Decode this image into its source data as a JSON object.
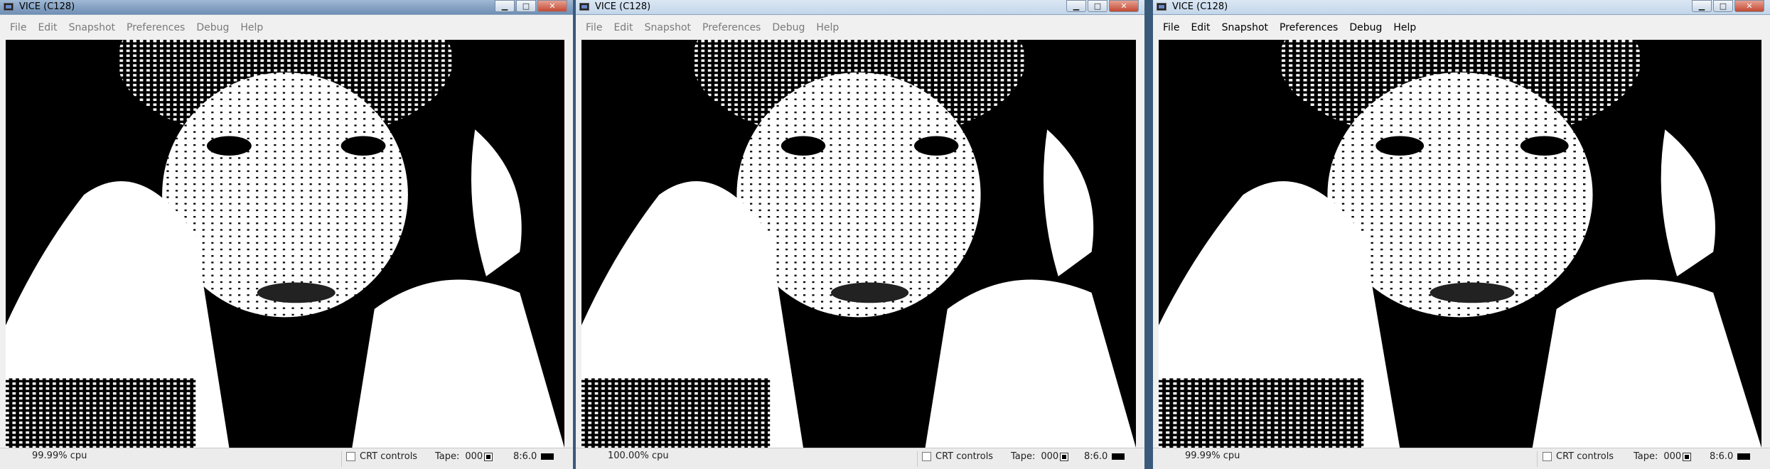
{
  "windows": [
    {
      "title": "VICE (C128)",
      "controls": {
        "minimize": "▁",
        "maximize": "□",
        "close": "✕"
      },
      "menu": [
        "File",
        "Edit",
        "Snapshot",
        "Preferences",
        "Debug",
        "Help"
      ],
      "status": {
        "cpu": "99.99% cpu",
        "crt": "CRT controls",
        "tape_label": "Tape:",
        "tape_counter": "000",
        "drive": "8:6.0"
      }
    },
    {
      "title": "VICE (C128)",
      "controls": {
        "minimize": "▁",
        "maximize": "□",
        "close": "✕"
      },
      "menu": [
        "File",
        "Edit",
        "Snapshot",
        "Preferences",
        "Debug",
        "Help"
      ],
      "status": {
        "cpu": "100.00% cpu",
        "crt": "CRT controls",
        "tape_label": "Tape:",
        "tape_counter": "000",
        "drive": "8:6.0"
      }
    },
    {
      "title": "VICE (C128)",
      "controls": {
        "minimize": "▁",
        "maximize": "□",
        "close": "✕"
      },
      "menu": [
        "File",
        "Edit",
        "Snapshot",
        "Preferences",
        "Debug",
        "Help"
      ],
      "status": {
        "cpu": "99.99% cpu",
        "crt": "CRT controls",
        "tape_label": "Tape:",
        "tape_counter": "000",
        "drive": "8:6.0"
      }
    }
  ],
  "colors": {
    "screen_bg": "#000000",
    "title_active": "#c2d6ea",
    "menu_bg": "#f0f0f0"
  },
  "icons": [
    "vice-app-icon",
    "minimize-icon",
    "maximize-icon",
    "close-icon",
    "tape-record-icon",
    "drive-led-icon"
  ]
}
